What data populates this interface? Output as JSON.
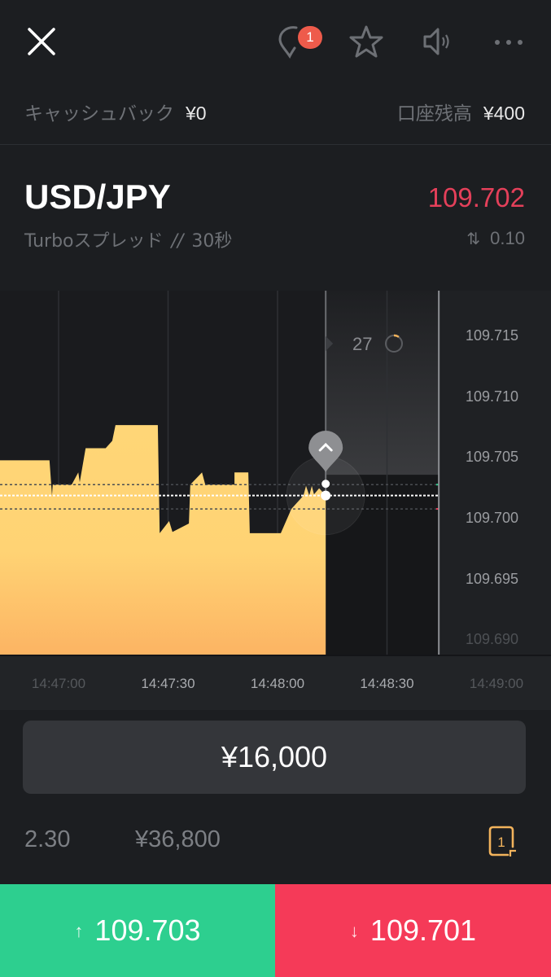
{
  "header": {
    "icons": [
      "close-icon",
      "notification-pin-icon",
      "star-icon",
      "speaker-icon",
      "more-icon"
    ],
    "notification_count": "1"
  },
  "balances": {
    "cashback_label": "キャッシュバック",
    "cashback_value": "¥0",
    "account_label": "口座残高",
    "account_value": "¥400"
  },
  "instrument": {
    "pair": "USD/JPY",
    "current_price": "109.702",
    "price_color": "#e4405a",
    "mode_label": "Turboスプレッド",
    "separator": "//",
    "duration": "30秒",
    "spread_icon": "up-down-arrows-icon",
    "spread_value": "0.10"
  },
  "chart_data": {
    "type": "area",
    "title": "USD/JPY",
    "xlabel": "",
    "ylabel": "",
    "x_unit": "seconds after 14:47:00",
    "ylim": [
      109.6888,
      109.7187
    ],
    "xlim": [
      -16.1,
      103.7
    ],
    "x_ticks": [
      {
        "t": 0,
        "label": "14:47:00",
        "faint": true
      },
      {
        "t": 30,
        "label": "14:47:30",
        "faint": false
      },
      {
        "t": 60,
        "label": "14:48:00",
        "faint": false
      },
      {
        "t": 90,
        "label": "14:48:30",
        "faint": false
      },
      {
        "t": 120,
        "label": "14:49:00",
        "faint": true
      }
    ],
    "y_ticks": [
      {
        "value": 109.715,
        "label": "109.715",
        "faint": false
      },
      {
        "value": 109.71,
        "label": "109.710",
        "faint": false
      },
      {
        "value": 109.705,
        "label": "109.705",
        "faint": false
      },
      {
        "value": 109.7,
        "label": "109.700",
        "faint": false
      },
      {
        "value": 109.695,
        "label": "109.695",
        "faint": false
      },
      {
        "value": 109.69,
        "label": "109.690",
        "faint": true
      }
    ],
    "grid": true,
    "series": [
      {
        "name": "USD/JPY price",
        "color": "#ffd475",
        "points": [
          [
            -16.1,
            109.7048
          ],
          [
            -2.5,
            109.7048
          ],
          [
            -1.8,
            109.7019
          ],
          [
            -1.6,
            109.7028
          ],
          [
            3.6,
            109.7028
          ],
          [
            5.4,
            109.7038
          ],
          [
            5.8,
            109.703
          ],
          [
            7.4,
            109.7058
          ],
          [
            12.9,
            109.7058
          ],
          [
            14.7,
            109.7064
          ],
          [
            15.6,
            109.7077
          ],
          [
            27.2,
            109.7077
          ],
          [
            27.7,
            109.6988
          ],
          [
            30.3,
            109.6998
          ],
          [
            31.2,
            109.6989
          ],
          [
            35.7,
            109.6996
          ],
          [
            36.1,
            109.7028
          ],
          [
            39.3,
            109.7038
          ],
          [
            40.2,
            109.7028
          ],
          [
            48.2,
            109.7028
          ],
          [
            48.2,
            109.7038
          ],
          [
            52.0,
            109.7038
          ],
          [
            52.4,
            109.6988
          ],
          [
            60.9,
            109.6988
          ],
          [
            63.8,
            109.7008
          ],
          [
            67.1,
            109.7019
          ],
          [
            67.8,
            109.7027
          ],
          [
            68.7,
            109.7019
          ],
          [
            69.4,
            109.7027
          ],
          [
            70.0,
            109.702
          ],
          [
            71.4,
            109.7025
          ],
          [
            73.2,
            109.7019
          ]
        ]
      }
    ],
    "current_price_line": 109.7019,
    "upper_strike_line": 109.7028,
    "lower_strike_line": 109.7008,
    "purchase_time": 73.2,
    "expiry_time": 104.2,
    "countdown_seconds": "27",
    "countdown_progress": 0.1
  },
  "trade": {
    "amount": "¥16,000",
    "payout_rate": "2.30",
    "payout_amount": "¥36,800",
    "open_trades_count": "1",
    "open_trades_color": "#f2b35c",
    "buy_icon": "up-arrow-icon",
    "buy_arrow": "↑",
    "buy_price": "109.703",
    "buy_color": "#2dcf8f",
    "sell_icon": "down-arrow-icon",
    "sell_arrow": "↓",
    "sell_price": "109.701",
    "sell_color": "#f53a58"
  }
}
